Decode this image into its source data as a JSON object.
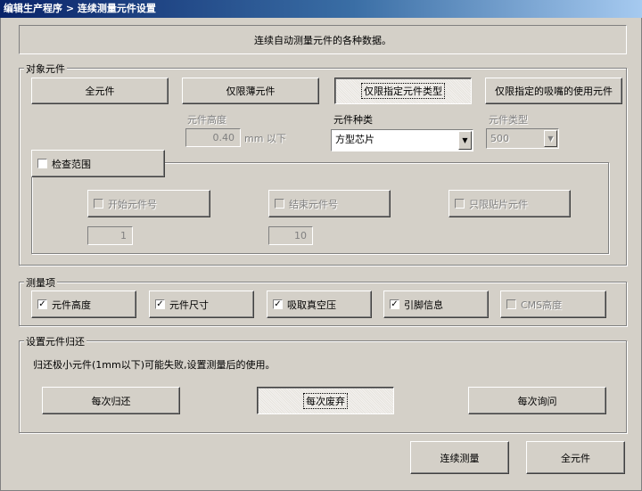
{
  "window": {
    "title": "编辑生产程序 > 连续测量元件设置"
  },
  "header": {
    "description": "连续自动测量元件的各种数据。"
  },
  "target_group": {
    "legend": "对象元件",
    "buttons": [
      "全元件",
      "仅限薄元件",
      "仅限指定元件类型",
      "仅限指定的吸嘴的使用元件"
    ],
    "height_label": "元件高度",
    "height_value": "0.40",
    "height_unit": "mm 以下",
    "type_label": "元件种类",
    "type_value": "方型芯片",
    "category_label": "元件类型",
    "category_value": "500",
    "check_range": "检查范围",
    "start_label": "开始元件号",
    "end_label": "结束元件号",
    "chip_only_label": "只限贴片元件",
    "start_value": "1",
    "end_value": "10"
  },
  "measure_group": {
    "legend": "测量项",
    "items": [
      {
        "label": "元件高度",
        "checked": true,
        "enabled": true
      },
      {
        "label": "元件尺寸",
        "checked": true,
        "enabled": true
      },
      {
        "label": "吸取真空压",
        "checked": true,
        "enabled": true
      },
      {
        "label": "引脚信息",
        "checked": true,
        "enabled": true
      },
      {
        "label": "CMS高度",
        "checked": false,
        "enabled": false
      }
    ]
  },
  "return_group": {
    "legend": "设置元件归还",
    "note": "归还极小元件(1mm以下)可能失败,设置测量后的使用。",
    "buttons": [
      "每次归还",
      "每次废弃",
      "每次询问"
    ]
  },
  "footer": {
    "measure_button": "连续测量",
    "all_button": "全元件"
  },
  "colors": {
    "face": "#d4d0c8",
    "title_start": "#0a246a",
    "title_end": "#a6caf0"
  }
}
